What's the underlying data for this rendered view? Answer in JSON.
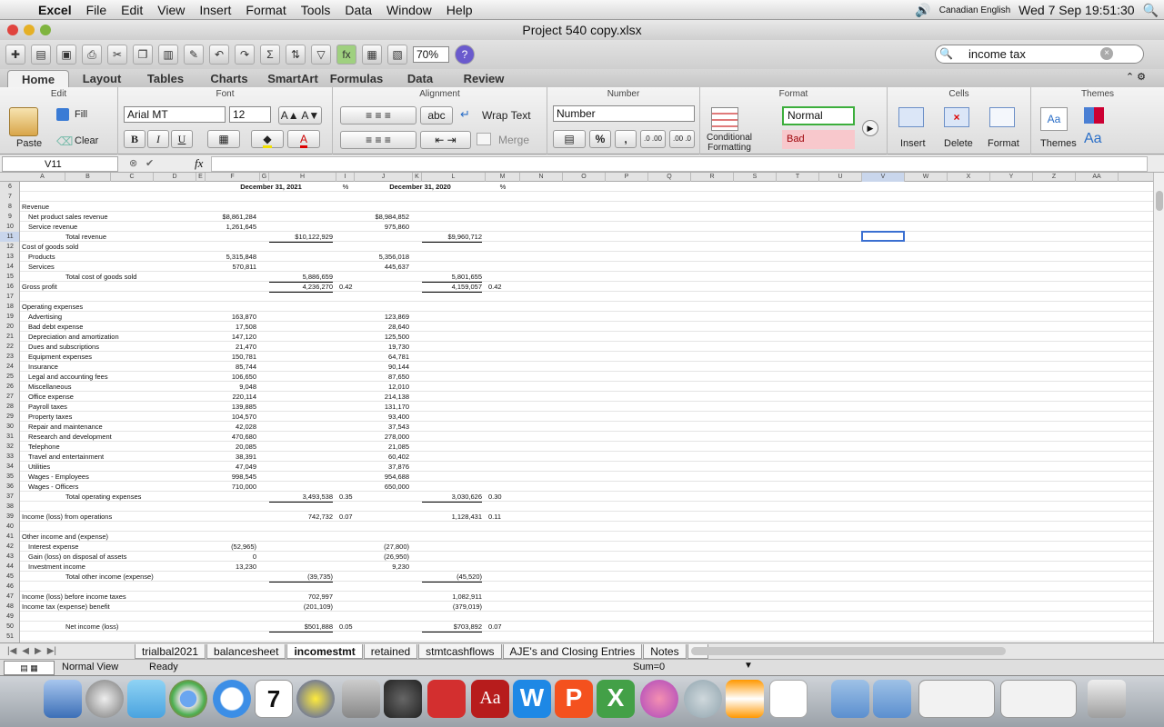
{
  "menubar": {
    "items": [
      "Excel",
      "File",
      "Edit",
      "View",
      "Insert",
      "Format",
      "Tools",
      "Data",
      "Window",
      "Help"
    ],
    "input_source": "Canadian English",
    "clock": "Wed 7 Sep  19:51:30"
  },
  "window": {
    "title": "Project 540 copy.xlsx"
  },
  "toolbar": {
    "zoom": "70%",
    "search_value": "income tax"
  },
  "ribbon": {
    "tabs": [
      "Home",
      "Layout",
      "Tables",
      "Charts",
      "SmartArt",
      "Formulas",
      "Data",
      "Review"
    ],
    "active_tab": "Home",
    "groups": {
      "edit": "Edit",
      "font": "Font",
      "alignment": "Alignment",
      "number": "Number",
      "format": "Format",
      "cells": "Cells",
      "themes": "Themes"
    },
    "paste": "Paste",
    "fill": "Fill",
    "clear": "Clear",
    "font_name": "Arial MT",
    "font_size": "12",
    "bold": "B",
    "italic": "I",
    "underline": "U",
    "abc": "abc",
    "wrap_text": "Wrap Text",
    "merge": "Merge",
    "number_format": "Number",
    "percent": "%",
    "comma": ",",
    "dec_inc": ".0 .00",
    "dec_dec": ".00 .0",
    "conditional_formatting": "Conditional Formatting",
    "style_normal": "Normal",
    "style_bad": "Bad",
    "insert": "Insert",
    "delete": "Delete",
    "format": "Format",
    "themes": "Themes",
    "font_a": "Aa",
    "aa_big": "Aa"
  },
  "formula_bar": {
    "name_box": "V11",
    "fx": "fx",
    "formula": ""
  },
  "columns": [
    "A",
    "B",
    "C",
    "D",
    "E",
    "F",
    "G",
    "H",
    "I",
    "J",
    "K",
    "L",
    "M",
    "N",
    "O",
    "P",
    "Q",
    "R",
    "S",
    "T",
    "U",
    "V",
    "W",
    "X",
    "Y",
    "Z",
    "AA"
  ],
  "rows": [
    "6",
    "7",
    "8",
    "9",
    "10",
    "11",
    "12",
    "13",
    "14",
    "15",
    "16",
    "17",
    "18",
    "19",
    "20",
    "21",
    "22",
    "23",
    "24",
    "25",
    "26",
    "27",
    "28",
    "29",
    "30",
    "31",
    "32",
    "33",
    "34",
    "35",
    "36",
    "37",
    "38",
    "39",
    "40",
    "41",
    "42",
    "43",
    "44",
    "45",
    "46",
    "47",
    "48",
    "49",
    "50",
    "51"
  ],
  "sheet": {
    "header_2021": "December 31, 2021",
    "header_pct1": "%",
    "header_2020": "December 31, 2020",
    "header_pct2": "%",
    "rows": [
      {
        "r": 8,
        "label": "Revenue",
        "ind": 0
      },
      {
        "r": 9,
        "label": "Net product sales revenue",
        "ind": 1,
        "f": "$8,861,284",
        "j": "$8,984,852"
      },
      {
        "r": 10,
        "label": "Service revenue",
        "ind": 1,
        "f": "1,261,645",
        "j": "975,860"
      },
      {
        "r": 11,
        "label": "Total revenue",
        "ind": 2,
        "h": "$10,122,929",
        "l": "$9,960,712"
      },
      {
        "r": 12,
        "label": "Cost of goods sold",
        "ind": 0
      },
      {
        "r": 13,
        "label": "Products",
        "ind": 1,
        "f": "5,315,848",
        "j": "5,356,018"
      },
      {
        "r": 14,
        "label": "Services",
        "ind": 1,
        "f": "570,811",
        "j": "445,637"
      },
      {
        "r": 15,
        "label": "Total cost of goods sold",
        "ind": 2,
        "h": "5,886,659",
        "l": "5,801,655"
      },
      {
        "r": 16,
        "label": "Gross profit",
        "ind": 0,
        "h": "4,236,270",
        "i": "0.42",
        "l": "4,159,057",
        "m": "0.42"
      },
      {
        "r": 18,
        "label": "Operating expenses",
        "ind": 0
      },
      {
        "r": 19,
        "label": "Advertising",
        "ind": 1,
        "f": "163,870",
        "j": "123,869"
      },
      {
        "r": 20,
        "label": "Bad debt expense",
        "ind": 1,
        "f": "17,508",
        "j": "28,640"
      },
      {
        "r": 21,
        "label": "Depreciation and amortization",
        "ind": 1,
        "f": "147,120",
        "j": "125,500"
      },
      {
        "r": 22,
        "label": "Dues and subscriptions",
        "ind": 1,
        "f": "21,470",
        "j": "19,730"
      },
      {
        "r": 23,
        "label": "Equipment expenses",
        "ind": 1,
        "f": "150,781",
        "j": "64,781"
      },
      {
        "r": 24,
        "label": "Insurance",
        "ind": 1,
        "f": "85,744",
        "j": "90,144"
      },
      {
        "r": 25,
        "label": "Legal and accounting fees",
        "ind": 1,
        "f": "106,650",
        "j": "87,650"
      },
      {
        "r": 26,
        "label": "Miscellaneous",
        "ind": 1,
        "f": "9,048",
        "j": "12,010"
      },
      {
        "r": 27,
        "label": "Office expense",
        "ind": 1,
        "f": "220,114",
        "j": "214,138"
      },
      {
        "r": 28,
        "label": "Payroll taxes",
        "ind": 1,
        "f": "139,885",
        "j": "131,170"
      },
      {
        "r": 29,
        "label": "Property taxes",
        "ind": 1,
        "f": "104,570",
        "j": "93,400"
      },
      {
        "r": 30,
        "label": "Repair and maintenance",
        "ind": 1,
        "f": "42,028",
        "j": "37,543"
      },
      {
        "r": 31,
        "label": "Research and development",
        "ind": 1,
        "f": "470,680",
        "j": "278,000"
      },
      {
        "r": 32,
        "label": "Telephone",
        "ind": 1,
        "f": "20,085",
        "j": "21,085"
      },
      {
        "r": 33,
        "label": "Travel and entertainment",
        "ind": 1,
        "f": "38,391",
        "j": "60,402"
      },
      {
        "r": 34,
        "label": "Utilities",
        "ind": 1,
        "f": "47,049",
        "j": "37,876"
      },
      {
        "r": 35,
        "label": "Wages - Employees",
        "ind": 1,
        "f": "998,545",
        "j": "954,688"
      },
      {
        "r": 36,
        "label": "Wages - Officers",
        "ind": 1,
        "f": "710,000",
        "j": "650,000"
      },
      {
        "r": 37,
        "label": "Total operating expenses",
        "ind": 2,
        "h": "3,493,538",
        "i": "0.35",
        "l": "3,030,626",
        "m": "0.30"
      },
      {
        "r": 39,
        "label": "Income (loss) from operations",
        "ind": 0,
        "h": "742,732",
        "i": "0.07",
        "l": "1,128,431",
        "m": "0.11"
      },
      {
        "r": 41,
        "label": "Other income and (expense)",
        "ind": 0
      },
      {
        "r": 42,
        "label": "Interest expense",
        "ind": 1,
        "f": "(52,965)",
        "j": "(27,800)"
      },
      {
        "r": 43,
        "label": "Gain (loss) on disposal of assets",
        "ind": 1,
        "f": "0",
        "j": "(26,950)"
      },
      {
        "r": 44,
        "label": "Investment income",
        "ind": 1,
        "f": "13,230",
        "j": "9,230"
      },
      {
        "r": 45,
        "label": "Total other income (expense)",
        "ind": 2,
        "h": "(39,735)",
        "l": "(45,520)"
      },
      {
        "r": 47,
        "label": "Income (loss) before income taxes",
        "ind": 0,
        "h": "702,997",
        "l": "1,082,911"
      },
      {
        "r": 48,
        "label": "Income tax (expense) benefit",
        "ind": 0,
        "h": "(201,109)",
        "l": "(379,019)"
      },
      {
        "r": 50,
        "label": "Net income (loss)",
        "ind": 2,
        "h": "$501,888",
        "i": "0.05",
        "l": "$703,892",
        "m": "0.07"
      }
    ]
  },
  "sheet_tabs": [
    "trialbal2021",
    "balancesheet",
    "incomestmt",
    "retained",
    "stmtcashflows",
    "AJE's and Closing Entries",
    "Notes"
  ],
  "active_sheet": "incomestmt",
  "statusbar": {
    "view": "Normal View",
    "ready": "Ready",
    "sum": "Sum=0"
  }
}
